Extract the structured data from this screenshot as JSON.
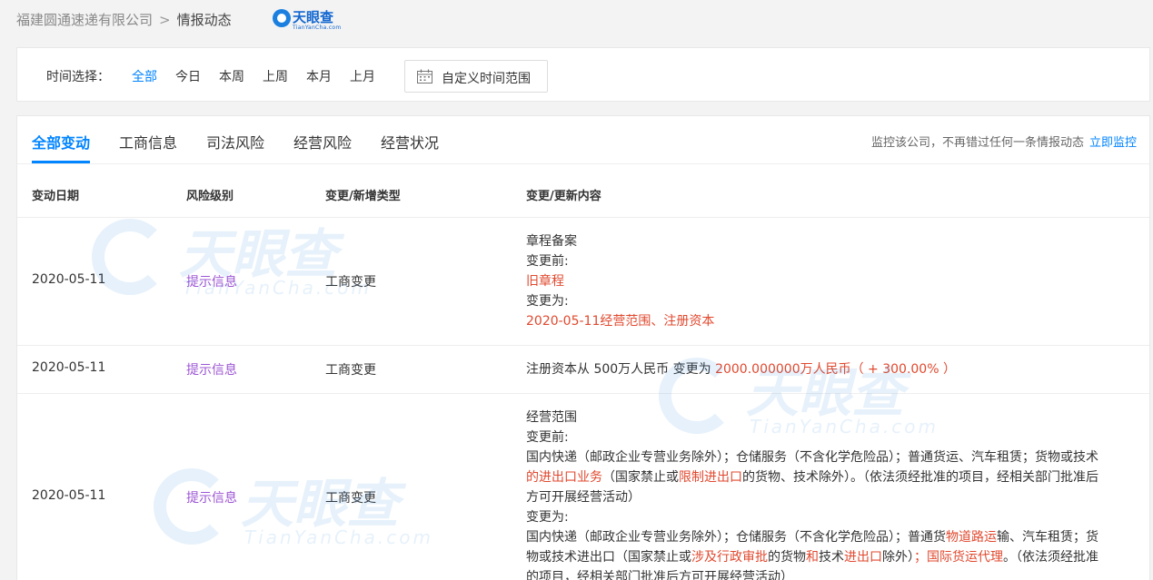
{
  "breadcrumb": {
    "company": "福建圆通速递有限公司",
    "separator": ">",
    "current": "情报动态"
  },
  "logo": {
    "name": "天眼查",
    "sub": "TianYanCha.com"
  },
  "time_filter": {
    "label": "时间选择：",
    "options": [
      "全部",
      "今日",
      "本周",
      "上周",
      "本月",
      "上月"
    ],
    "selected": "全部",
    "custom_button": "自定义时间范围"
  },
  "tabs": {
    "items": [
      "全部变动",
      "工商信息",
      "司法风险",
      "经营风险",
      "经营状况"
    ],
    "active": "全部变动"
  },
  "monitor": {
    "text": "监控该公司，不再错过任何一条情报动态",
    "link": "立即监控"
  },
  "table": {
    "headers": [
      "变动日期",
      "风险级别",
      "变更/新增类型",
      "变更/更新内容"
    ],
    "rows": [
      {
        "date": "2020-05-11",
        "risk": "提示信息",
        "type": "工商变更",
        "lines": [
          [
            {
              "t": "章程备案",
              "hl": false
            }
          ],
          [
            {
              "t": "变更前:",
              "hl": false
            }
          ],
          [
            {
              "t": "旧章程",
              "hl": true
            }
          ],
          [
            {
              "t": "变更为:",
              "hl": false
            }
          ],
          [
            {
              "t": "2020-05-11经营范围、注册资本",
              "hl": true
            }
          ]
        ]
      },
      {
        "date": "2020-05-11",
        "risk": "提示信息",
        "type": "工商变更",
        "lines": [
          [
            {
              "t": "注册资本从 500万人民币 变更为 ",
              "hl": false
            },
            {
              "t": "2000.000000万人民币（ + 300.00% ）",
              "hl": true
            }
          ]
        ]
      },
      {
        "date": "2020-05-11",
        "risk": "提示信息",
        "type": "工商变更",
        "lines": [
          [
            {
              "t": "经营范围",
              "hl": false
            }
          ],
          [
            {
              "t": "变更前:",
              "hl": false
            }
          ],
          [
            {
              "t": "国内快递（邮政企业专营业务除外）；仓储服务（不含化学危险品）；普通货运、汽车租赁；货物或技术",
              "hl": false
            }
          ],
          [
            {
              "t": "的进出口",
              "hl": true
            },
            {
              "t": "业务",
              "hl": true
            },
            {
              "t": "（国家禁止或",
              "hl": false
            },
            {
              "t": "限制进出口",
              "hl": true
            },
            {
              "t": "的货物、技术除外）。（依法须经批准的项目，经相关部门批准后",
              "hl": false
            }
          ],
          [
            {
              "t": "方可开展经营活动）",
              "hl": false
            }
          ],
          [
            {
              "t": "变更为:",
              "hl": false
            }
          ],
          [
            {
              "t": "国内快递（邮政企业专营业务除外）；仓储服务（不含化学危险品）；普通货",
              "hl": false
            },
            {
              "t": "物道路运",
              "hl": true
            },
            {
              "t": "输、汽车租赁；货",
              "hl": false
            }
          ],
          [
            {
              "t": "物或技术进出口（国家禁止或",
              "hl": false
            },
            {
              "t": "涉及行政审批",
              "hl": true
            },
            {
              "t": "的货物",
              "hl": false
            },
            {
              "t": "和",
              "hl": true
            },
            {
              "t": "技术",
              "hl": false
            },
            {
              "t": "进出口",
              "hl": true
            },
            {
              "t": "除外）",
              "hl": false
            },
            {
              "t": "；国际货运代理",
              "hl": true
            },
            {
              "t": "。（依法须经批准",
              "hl": false
            }
          ],
          [
            {
              "t": "的项目，经相关部门批准后方可开展经营活动）",
              "hl": false
            }
          ]
        ]
      }
    ]
  },
  "watermark": {
    "text": "天眼查",
    "sub": "TianYanCha.com"
  },
  "colors": {
    "accent": "#0084ff",
    "highlight": "#e0492f",
    "risk": "#9c55d4"
  }
}
